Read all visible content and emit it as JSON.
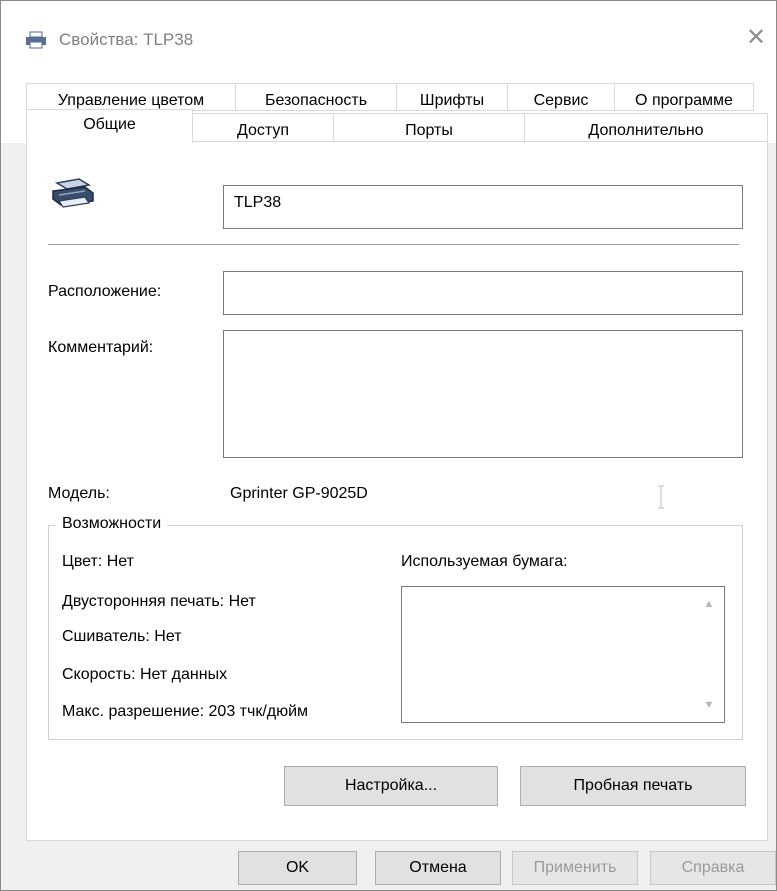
{
  "window": {
    "title": "Свойства: TLP38",
    "close_icon": "close-icon"
  },
  "tabs_top": [
    "Управление цветом",
    "Безопасность",
    "Шрифты",
    "Сервис",
    "О программе"
  ],
  "tabs_bottom": [
    "Общие",
    "Доступ",
    "Порты",
    "Дополнительно"
  ],
  "active_tab": "Общие",
  "general": {
    "printer_name": "TLP38",
    "location_label": "Расположение:",
    "location_value": "",
    "comment_label": "Комментарий:",
    "comment_value": "",
    "model_label": "Модель:",
    "model_value": "Gprinter GP-9025D"
  },
  "features": {
    "title": "Возможности",
    "color": "Цвет: Нет",
    "duplex": "Двусторонняя печать: Нет",
    "stapler": "Сшиватель: Нет",
    "speed": "Скорость: Нет данных",
    "max_resolution": "Макс. разрешение: 203 тчк/дюйм",
    "paper_label": "Используемая бумага:"
  },
  "buttons": {
    "settings": "Настройка...",
    "test_print": "Пробная печать",
    "ok": "OK",
    "cancel": "Отмена",
    "apply": "Применить",
    "help": "Справка"
  }
}
